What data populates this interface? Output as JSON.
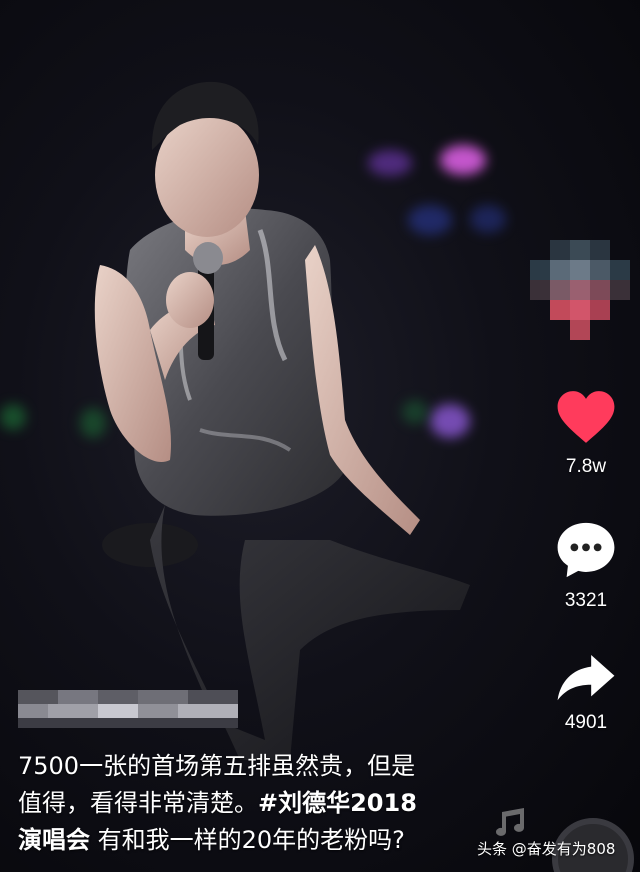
{
  "video": {
    "description": "Singer performing on stage holding a microphone"
  },
  "actions": {
    "likes": "7.8w",
    "comments": "3321",
    "shares": "4901"
  },
  "caption": {
    "line1": "7500一张的首场第五排虽然贵，但是",
    "line2_plain": "值得，看得非常清楚。",
    "line2_tag": "#刘德华2018",
    "line3_tag": "演唱会",
    "line3_plain": " 有和我一样的20年的老粉吗?"
  },
  "watermark": {
    "brand": "头条",
    "handle": "@奋发有为808"
  },
  "colors": {
    "like": "#ff3b5c",
    "text": "#ffffff"
  }
}
